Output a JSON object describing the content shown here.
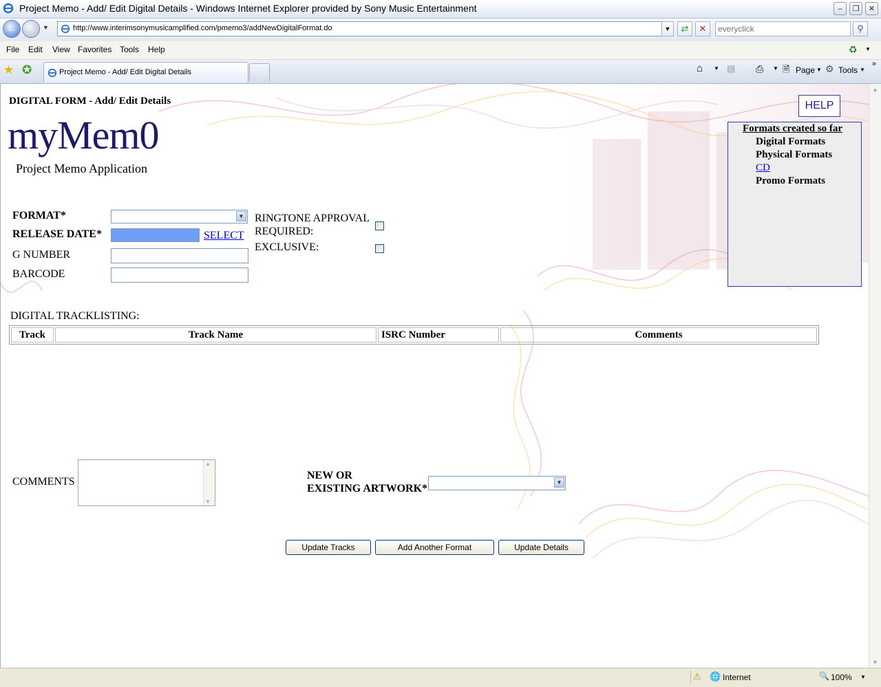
{
  "window": {
    "title": "Project Memo - Add/ Edit Digital Details - Windows Internet Explorer provided by Sony Music Entertainment",
    "url": "http://www.interimsonymusicamplified.com/pmemo3/addNewDigitalFormat.do",
    "search_placeholder": "everyclick"
  },
  "menu": [
    "File",
    "Edit",
    "View",
    "Favorites",
    "Tools",
    "Help"
  ],
  "tab": {
    "label": "Project Memo - Add/ Edit Digital Details"
  },
  "toolbar": {
    "page_label": "Page",
    "tools_label": "Tools"
  },
  "page": {
    "heading": "DIGITAL FORM - Add/ Edit Details",
    "logo_text": "myMem0",
    "app_subtitle": "Project Memo Application",
    "help_label": "HELP"
  },
  "form": {
    "format_label": "FORMAT*",
    "release_date_label": "RELEASE DATE*",
    "select_link": "SELECT",
    "g_number_label": "G NUMBER",
    "barcode_label": "BARCODE",
    "ringtone_label_1": "RINGTONE APPROVAL",
    "ringtone_label_2": "REQUIRED:",
    "exclusive_label": "EXCLUSIVE:"
  },
  "formats_panel": {
    "title": "Formats created so far",
    "digital": "Digital Formats",
    "physical": "Physical Formats",
    "cd_link": "CD",
    "promo": "Promo Formats"
  },
  "tracklisting": {
    "label": "DIGITAL TRACKLISTING:",
    "columns": [
      "Track",
      "Track Name",
      "ISRC Number",
      "Comments"
    ]
  },
  "bottom": {
    "comments_label": "COMMENTS",
    "artwork_label_1": "NEW OR",
    "artwork_label_2": "EXISTING ARTWORK*"
  },
  "buttons": {
    "update_tracks": "Update Tracks",
    "add_format": "Add Another Format",
    "update_details": "Update Details"
  },
  "status": {
    "zone": "Internet",
    "zoom": "100%"
  }
}
